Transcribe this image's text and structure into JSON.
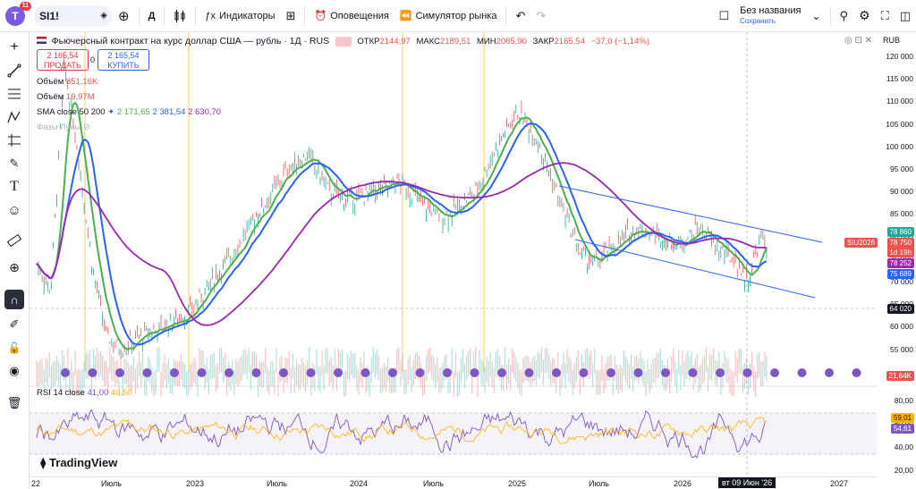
{
  "topbar": {
    "avatar": "T",
    "avatar_badge": "11",
    "symbol": "SI1!",
    "interval": "Д",
    "indicators": "Индикаторы",
    "alerts": "Оповещения",
    "replay": "Симулятор рынка",
    "layout_name": "Без названия",
    "layout_status": "Сохранить"
  },
  "legend": {
    "title": "Фьючерсный контракт на курс доллар США — рубль · 1Д · RUS",
    "open_label": "ОТКР",
    "open": "2144,97",
    "high_label": "МАКС",
    "high": "2189,51",
    "low_label": "МИН",
    "low": "2085,90",
    "close_label": "ЗАКР",
    "close": "2165,54",
    "change": "−37,0 (−1,14%)",
    "sell_price": "2 165,54",
    "sell_label": "ПРОДАТЬ",
    "spread": "0",
    "buy_price": "2 165,54",
    "buy_label": "КУПИТЬ",
    "vol1_label": "Объём",
    "vol1": "851,16K",
    "vol2_label": "Объём",
    "vol2": "19,97M",
    "sma_label": "SMA close 50 200",
    "sma1": "2 171,65",
    "sma2": "2 381,54",
    "sma3": "2 630,70",
    "moon_label": "Фазы Луны",
    "rsi_label": "RSI 14 close",
    "rsi1": "41,00",
    "rsi2": "40,50",
    "brand": "TradingView"
  },
  "price_axis": {
    "currency": "RUB",
    "ticks": [
      "120 000",
      "115 000",
      "110 000",
      "105 000",
      "100 000",
      "95 000",
      "90 000",
      "85 000",
      "80 000",
      "75 000",
      "70 000",
      "65 000",
      "60 000",
      "55 000"
    ],
    "tags": {
      "high": "78 860",
      "symbol": "SIU2026",
      "last": "78 750",
      "countdown": "1d 19h",
      "sma_a": "78 252",
      "sma_b": "75 689",
      "crosshair": "64 020",
      "volume": "21,64K"
    }
  },
  "rsi_axis": {
    "ticks": [
      "80,00",
      "60,00",
      "40,00",
      "20,00"
    ],
    "tags": {
      "a": "59,01",
      "b": "54,61"
    }
  },
  "time_axis": {
    "labels": [
      "22",
      "Июль",
      "2023",
      "Июль",
      "2024",
      "Июль",
      "2025",
      "Июль",
      "2026",
      "2027"
    ],
    "crosshair": "вт 09 Июн '26"
  },
  "colors": {
    "up": "#26a69a",
    "down": "#ef5350",
    "sma50": "#2962ff",
    "sma_green": "#4caf50",
    "sma200": "#9c27b0",
    "channel": "#2962ff",
    "rsi": "#7e57c2",
    "rsi_ma": "#ffb300",
    "moon": "#7e57c2",
    "vline": "#f9d648"
  },
  "chart_data": {
    "type": "candlestick",
    "x_range": [
      "2022-03",
      "2027-02"
    ],
    "y_range": [
      50000,
      122000
    ],
    "series": [
      {
        "name": "price",
        "points": [
          [
            0,
            76000
          ],
          [
            2,
            70000
          ],
          [
            4,
            120000
          ],
          [
            6,
            100000
          ],
          [
            8,
            75000
          ],
          [
            10,
            60000
          ],
          [
            12,
            57000
          ],
          [
            15,
            60000
          ],
          [
            18,
            62000
          ],
          [
            22,
            65000
          ],
          [
            25,
            72000
          ],
          [
            28,
            78000
          ],
          [
            30,
            83000
          ],
          [
            33,
            90000
          ],
          [
            36,
            97000
          ],
          [
            39,
            100000
          ],
          [
            42,
            92000
          ],
          [
            45,
            90000
          ],
          [
            48,
            92000
          ],
          [
            52,
            94000
          ],
          [
            55,
            90000
          ],
          [
            58,
            86000
          ],
          [
            60,
            88000
          ],
          [
            63,
            92000
          ],
          [
            66,
            102000
          ],
          [
            69,
            110000
          ],
          [
            72,
            103000
          ],
          [
            75,
            90000
          ],
          [
            78,
            78000
          ],
          [
            80,
            76000
          ],
          [
            83,
            80000
          ],
          [
            86,
            84000
          ],
          [
            89,
            82000
          ],
          [
            92,
            80000
          ],
          [
            95,
            84000
          ],
          [
            98,
            79000
          ],
          [
            100,
            77000
          ],
          [
            102,
            72000
          ],
          [
            104,
            82000
          ],
          [
            105,
            78750
          ]
        ]
      }
    ]
  }
}
